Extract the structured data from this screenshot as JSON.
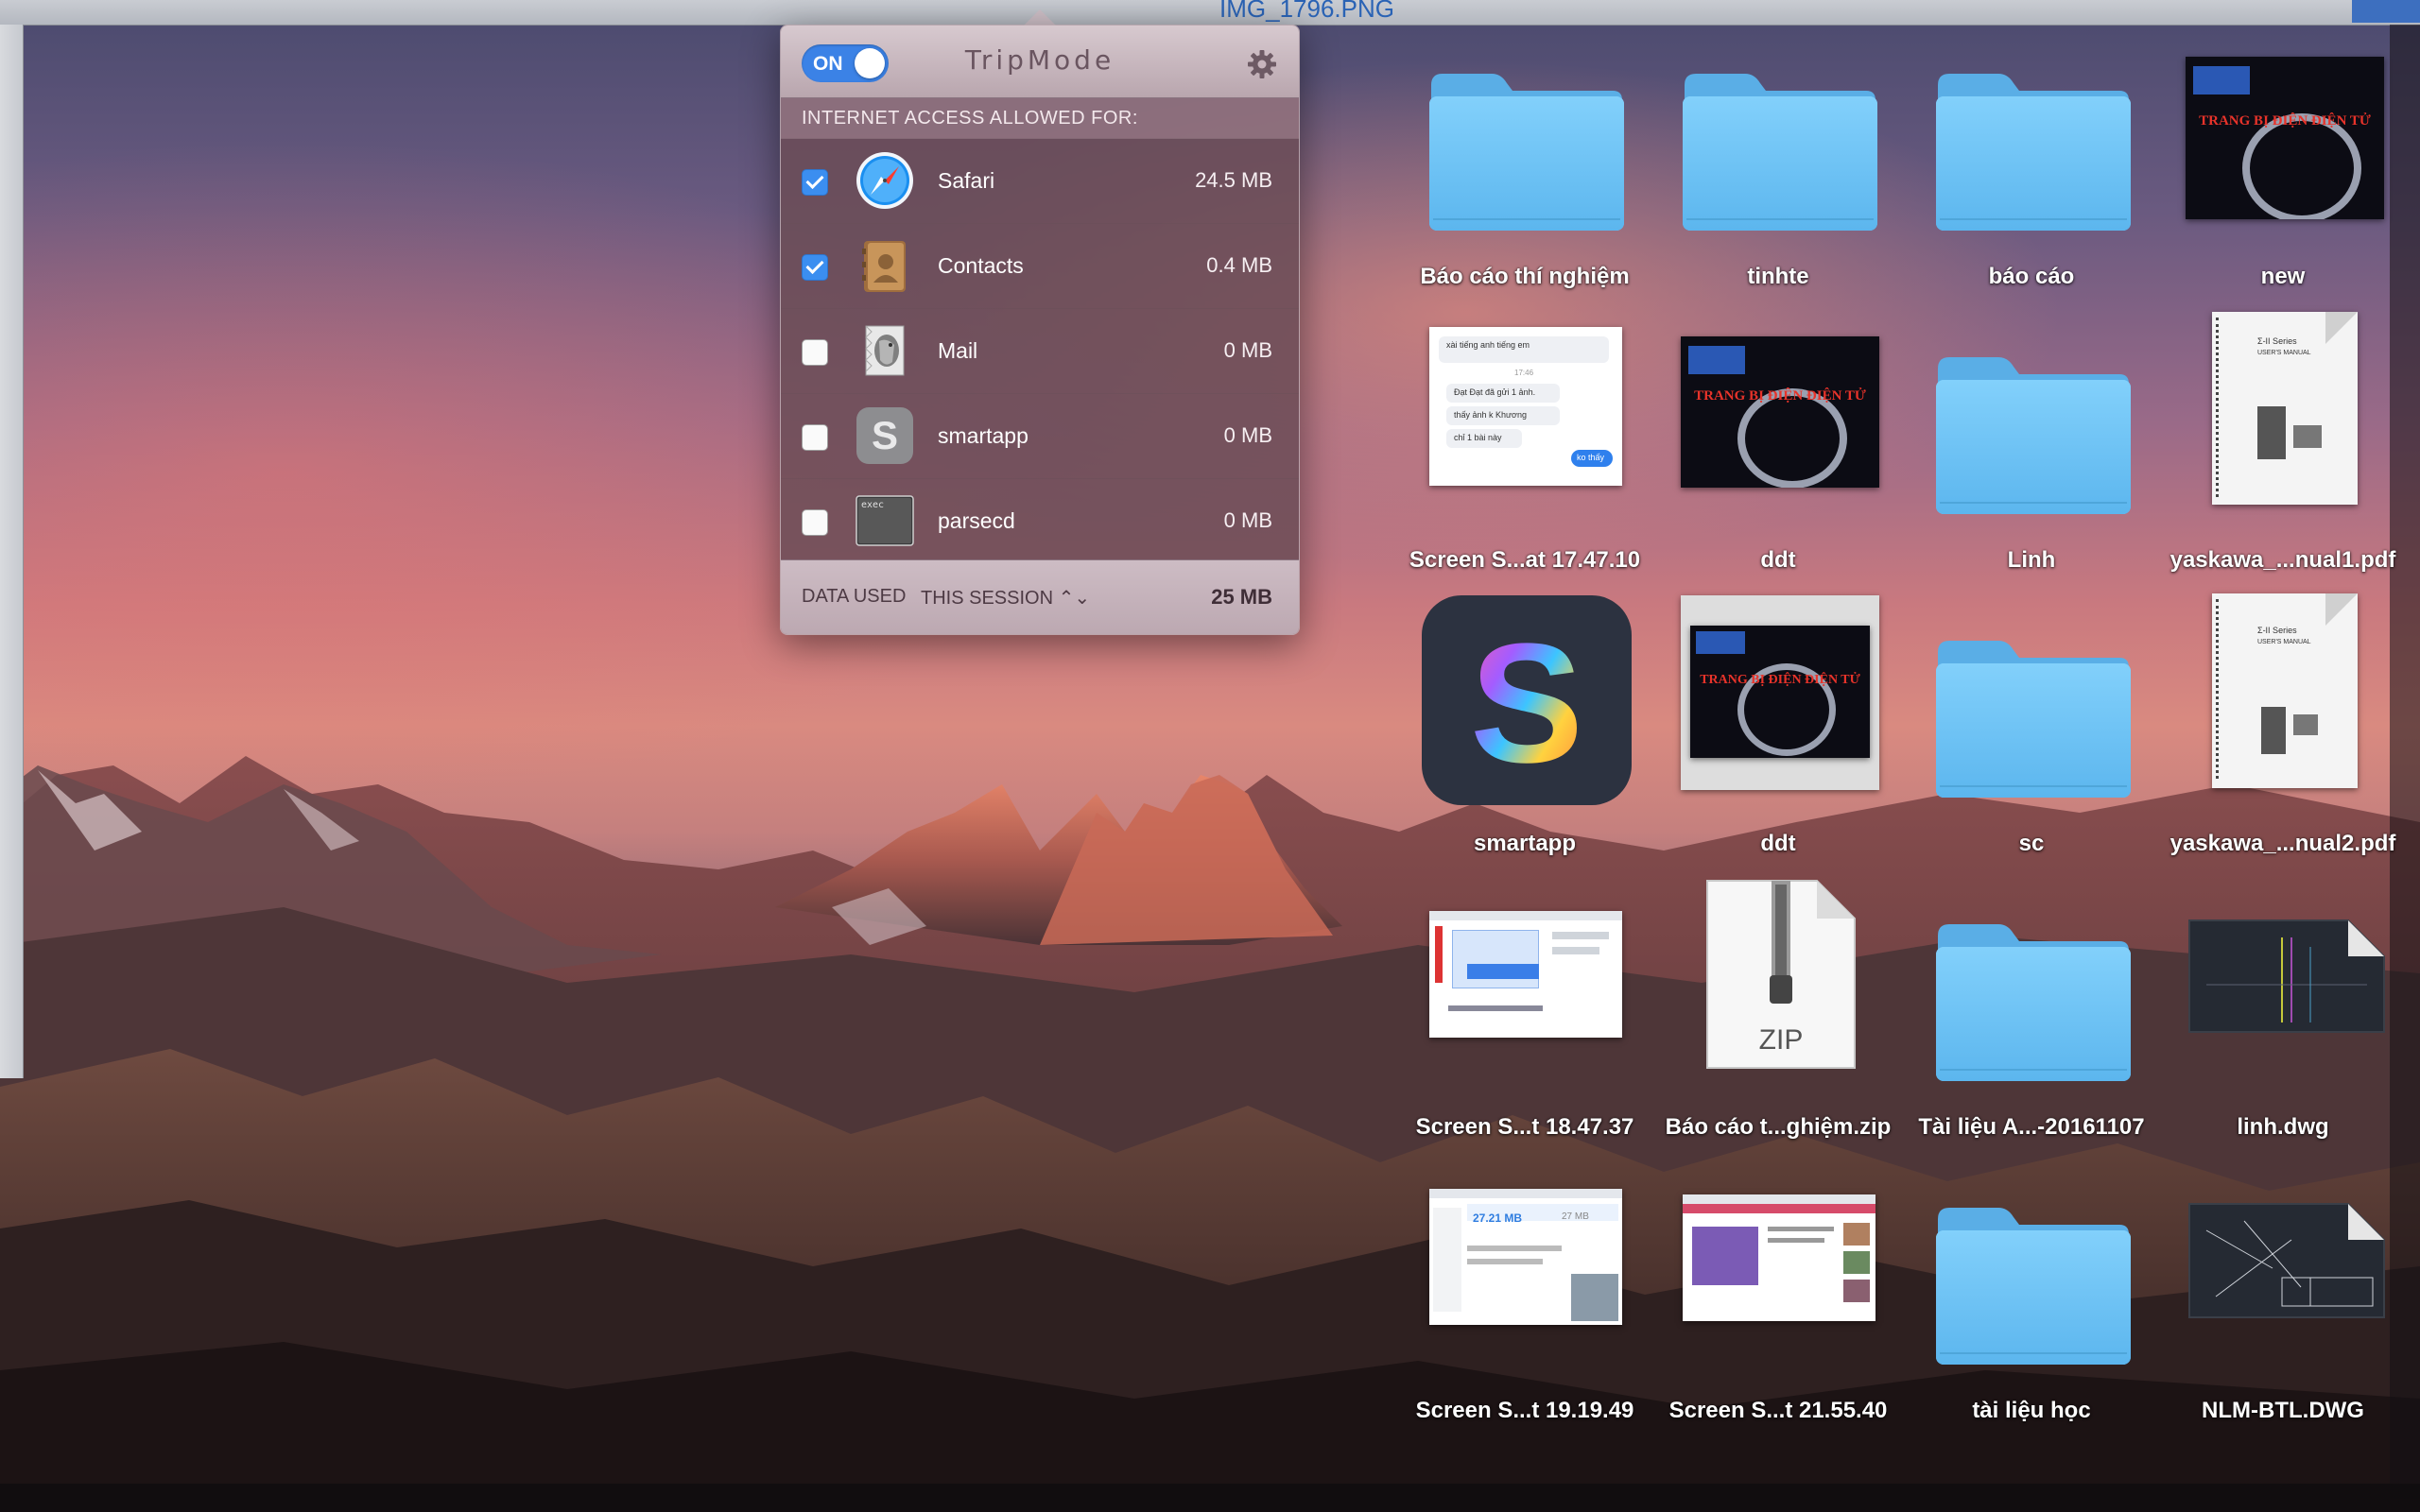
{
  "window_strip": {
    "filename": "IMG_1796.PNG"
  },
  "tripmode": {
    "toggle_label": "ON",
    "title": "TripMode",
    "section_header": "INTERNET ACCESS ALLOWED FOR:",
    "apps": [
      {
        "name": "Safari",
        "size": "24.5 MB",
        "checked": true,
        "icon": "safari-icon"
      },
      {
        "name": "Contacts",
        "size": "0.4 MB",
        "checked": true,
        "icon": "contacts-icon"
      },
      {
        "name": "Mail",
        "size": "0 MB",
        "checked": false,
        "icon": "mail-icon"
      },
      {
        "name": "smartapp",
        "size": "0 MB",
        "checked": false,
        "icon": "smartapp-icon"
      },
      {
        "name": "parsecd",
        "size": "0 MB",
        "checked": false,
        "icon": "exec-icon"
      }
    ],
    "footer_label": "DATA USED",
    "footer_period": "THIS SESSION ⌃⌄",
    "footer_total": "25 MB",
    "accent": "#3b82e6"
  },
  "desktop": {
    "icons": [
      {
        "label": "Báo cáo thí nghiệm",
        "kind": "folder"
      },
      {
        "label": "tinhte",
        "kind": "folder"
      },
      {
        "label": "báo cáo",
        "kind": "folder"
      },
      {
        "label": "new",
        "kind": "presentation"
      },
      {
        "label": "Screen S...at 17.47.10",
        "kind": "screenshot"
      },
      {
        "label": "ddt",
        "kind": "presentation"
      },
      {
        "label": "Linh",
        "kind": "folder"
      },
      {
        "label": "yaskawa_...nual1.pdf",
        "kind": "pdf"
      },
      {
        "label": "smartapp",
        "kind": "app"
      },
      {
        "label": "ddt",
        "kind": "presentation"
      },
      {
        "label": "sc",
        "kind": "folder"
      },
      {
        "label": "yaskawa_...nual2.pdf",
        "kind": "pdf"
      },
      {
        "label": "Screen S...t 18.47.37",
        "kind": "screenshot"
      },
      {
        "label": "Báo cáo t...ghiệm.zip",
        "kind": "zip"
      },
      {
        "label": "Tài liệu A...-20161107",
        "kind": "folder"
      },
      {
        "label": "linh.dwg",
        "kind": "dwg"
      },
      {
        "label": "Screen S...t 19.19.49",
        "kind": "screenshot"
      },
      {
        "label": "Screen S...t 21.55.40",
        "kind": "screenshot"
      },
      {
        "label": "tài liệu học",
        "kind": "folder"
      },
      {
        "label": "NLM-BTL.DWG",
        "kind": "dwg"
      }
    ],
    "zip_text": "ZIP",
    "exec_text": "exec",
    "smartapp_glyph": "S",
    "slide_text": "TRANG BỊ ĐIỆN ĐIỆN TỬ",
    "chat_lines": [
      "xài tiếng anh tiếng em",
      "17:46",
      "Đạt Đạt đã gửi 1 ảnh.",
      "thấy ảnh k Khương",
      "chỉ 1 bài này",
      "ko thấy"
    ],
    "pdf_lines": [
      "Σ-II Series",
      "USER'S MANUAL"
    ],
    "screenshot_values": [
      "27.21 MB",
      "27 MB"
    ]
  }
}
